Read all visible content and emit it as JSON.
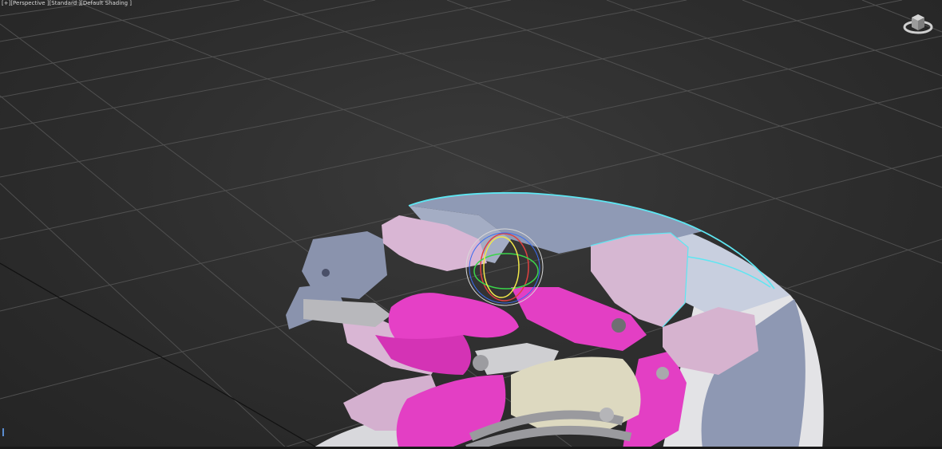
{
  "viewport": {
    "labels": [
      "[+]",
      "[Perspective ]",
      "[Standard ]",
      "[Default Shading ]"
    ]
  },
  "icons": {
    "viewcube": "viewcube-icon"
  },
  "colors": {
    "background": "#2d2d2d",
    "grid": "#4a4a4a",
    "selection_outline": "#5ee6f2",
    "magenta_parts": "#e33fc4",
    "pink_parts": "#d6b3d2",
    "blue_grey_parts": "#8c96ad",
    "cream_parts": "#ddd9c0"
  }
}
